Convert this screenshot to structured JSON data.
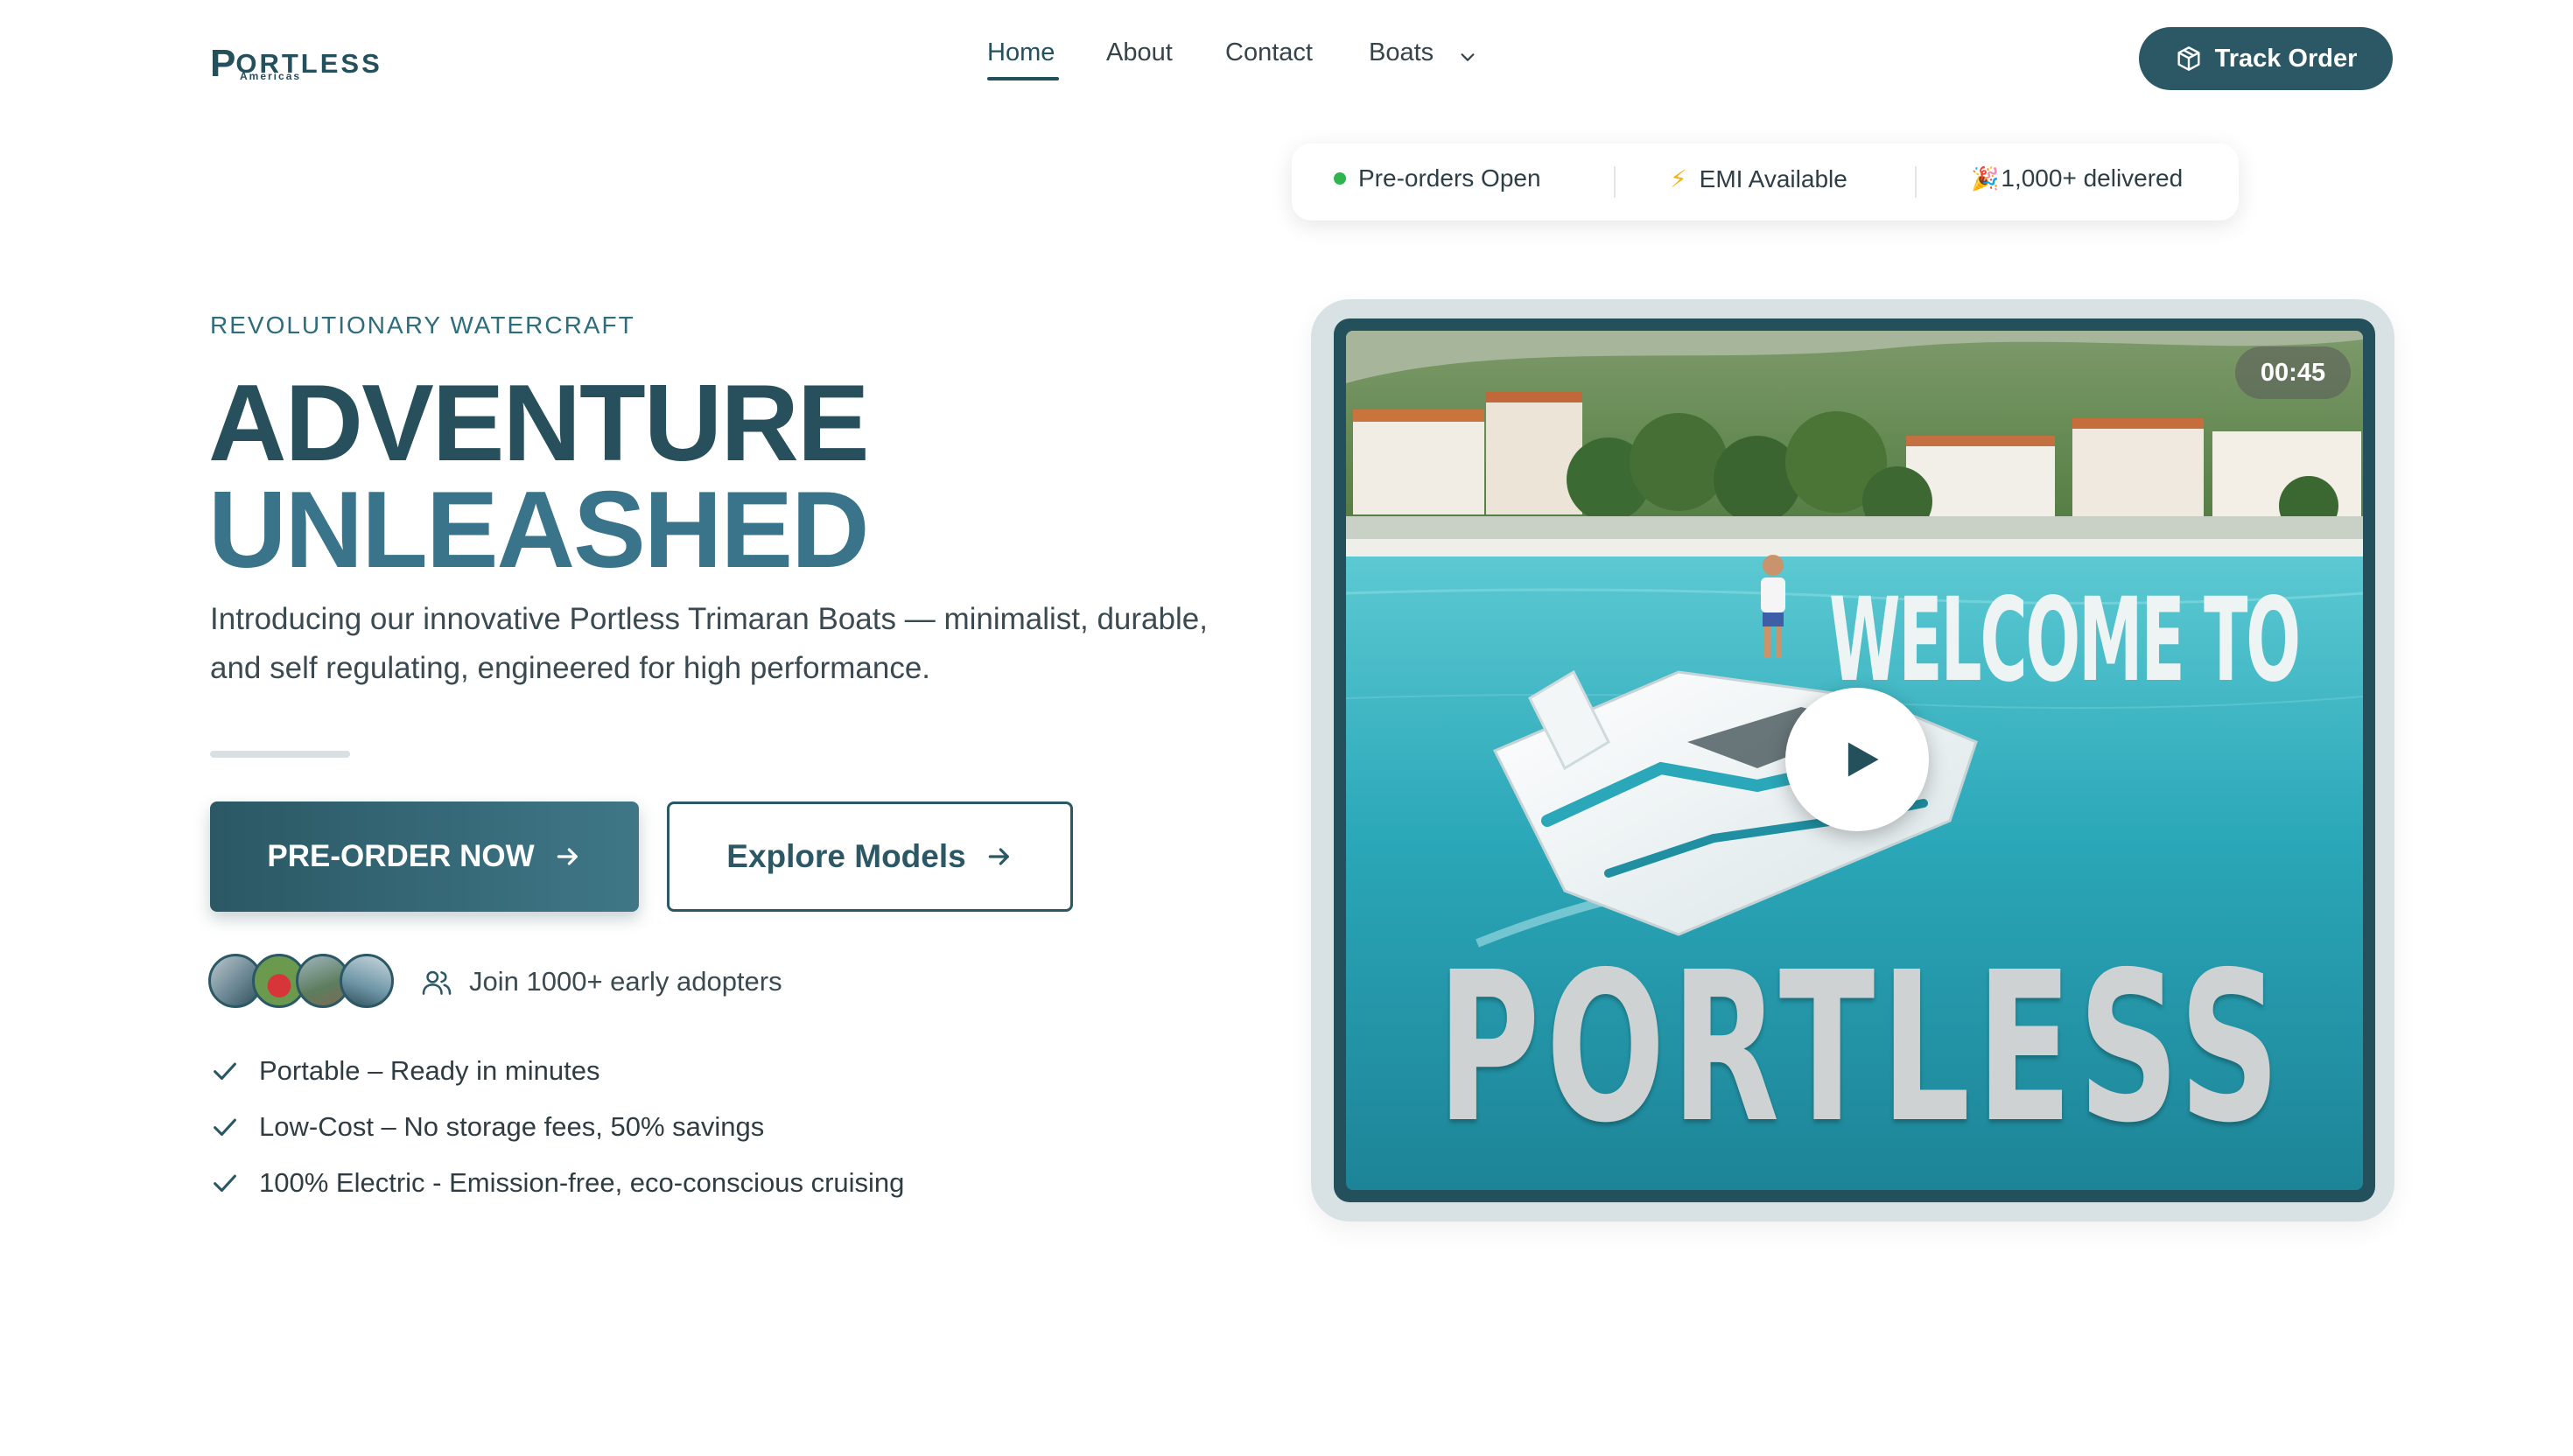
{
  "brand": {
    "name": "PORTLESS",
    "sub": "Americas"
  },
  "nav": {
    "items": [
      {
        "label": "Home",
        "active": true
      },
      {
        "label": "About"
      },
      {
        "label": "Contact"
      },
      {
        "label": "Boats",
        "dropdown": true
      }
    ],
    "cta_label": "Track Order",
    "cta_icon": "package-icon"
  },
  "status_bar": [
    {
      "label": "Pre-orders Open",
      "icon": "green-dot"
    },
    {
      "label": "EMI Available",
      "icon": "lightning-icon"
    },
    {
      "label": "1,000+ delivered",
      "icon": "party-popper-icon",
      "icon_glyph": "🎉"
    }
  ],
  "hero": {
    "eyebrow": "REVOLUTIONARY WATERCRAFT",
    "headline_line1": "ADVENTURE",
    "headline_line2": "UNLEASHED",
    "lead": "Introducing our innovative Portless Trimaran Boats — minimalist, durable, and self regulating, engineered for high performance.",
    "primary_cta": "PRE-ORDER NOW",
    "secondary_cta": "Explore Models",
    "adopters_text": "Join 1000+ early adopters",
    "features": [
      "Portable – Ready in minutes",
      "Low-Cost – No storage fees, 50% savings",
      "100% Electric - Emission-free, eco-conscious cruising"
    ]
  },
  "video": {
    "duration": "00:45",
    "overlay_top": "WELCOME TO",
    "overlay_bottom": "PORTLESS"
  },
  "colors": {
    "primary": "#2b5864",
    "headline_dark": "#27505c",
    "headline_light": "#39748a",
    "status_dot": "#2fb44f",
    "sea": "#2aa7b8"
  }
}
